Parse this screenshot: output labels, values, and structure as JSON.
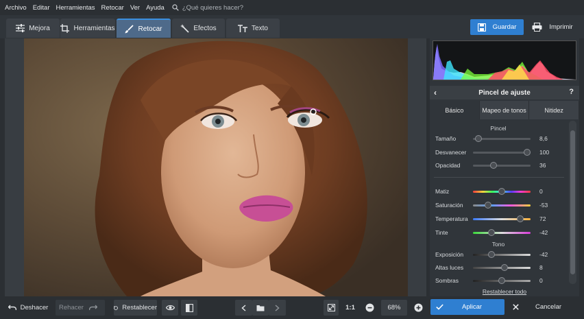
{
  "menu": {
    "items": [
      "Archivo",
      "Editar",
      "Herramientas",
      "Retocar",
      "Ver",
      "Ayuda"
    ],
    "search_placeholder": "¿Qué quieres hacer?"
  },
  "tabs": [
    {
      "label": "Mejora",
      "icon": "sliders-icon"
    },
    {
      "label": "Herramientas",
      "icon": "crop-icon"
    },
    {
      "label": "Retocar",
      "icon": "brush-icon",
      "active": true
    },
    {
      "label": "Efectos",
      "icon": "magic-wand-icon"
    },
    {
      "label": "Texto",
      "icon": "text-icon"
    }
  ],
  "actions": {
    "save": "Guardar",
    "print": "Imprimir"
  },
  "panel": {
    "title": "Pincel de ajuste",
    "back": "‹",
    "help": "?",
    "subtabs": [
      "Básico",
      "Mapeo de tonos",
      "Nitidez"
    ],
    "sections": {
      "pincel": "Pincel",
      "tono": "Tono"
    },
    "brush": [
      {
        "label": "Tamaño",
        "value": "8,6",
        "level": 0.08
      },
      {
        "label": "Desvanecer",
        "value": "100",
        "level": 1.0
      },
      {
        "label": "Opacidad",
        "value": "36",
        "level": 0.36
      }
    ],
    "color": [
      {
        "label": "Matiz",
        "value": "0",
        "level": 0.5
      },
      {
        "label": "Saturación",
        "value": "-53",
        "level": 0.24
      },
      {
        "label": "Temperatura",
        "value": "72",
        "level": 0.86
      },
      {
        "label": "Tinte",
        "value": "-42",
        "level": 0.29
      }
    ],
    "tone": [
      {
        "label": "Exposición",
        "value": "-42",
        "level": 0.29
      },
      {
        "label": "Altas luces",
        "value": "8",
        "level": 0.54
      },
      {
        "label": "Sombras",
        "value": "0",
        "level": 0.5
      }
    ],
    "reset_all": "Restablecer todo"
  },
  "bottom": {
    "undo": "Deshacer",
    "redo": "Rehacer",
    "reset": "Restablecer",
    "zoom_1to1": "1:1",
    "zoom": "68%",
    "apply": "Aplicar",
    "cancel": "Cancelar"
  },
  "colors": {
    "accent": "#2f7fd1",
    "active_tab": "#4e6a8a"
  }
}
